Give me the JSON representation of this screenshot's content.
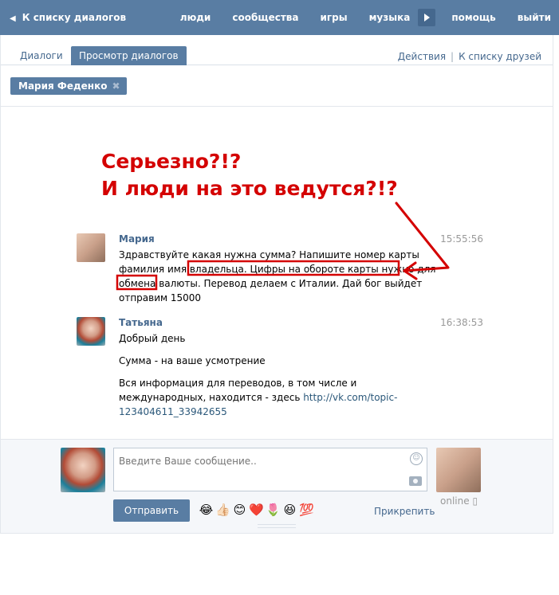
{
  "topbar": {
    "back_label": "К списку диалогов",
    "nav": [
      "люди",
      "сообщества",
      "игры",
      "музыка",
      "помощь",
      "выйти"
    ]
  },
  "tabs": {
    "items": [
      "Диалоги",
      "Просмотр диалогов"
    ],
    "actions_label": "Действия",
    "friends_label": "К списку друзей"
  },
  "chip": {
    "name": "Мария Феденко",
    "remove": "✖"
  },
  "annotation": {
    "line1": "Серьезно?!?",
    "line2": "И люди на это ведутся?!?",
    "color": "#d40000"
  },
  "messages": [
    {
      "name": "Мария",
      "time": "15:55:56",
      "lines": [
        "Здравствуйте какая нужна сумма? Напишите номер карты фамилия имя владельца. Цифры на обороте карты нужно для обмена валюты. Перевод делаем с Италии. Дай бог выйдет отправим 15000"
      ]
    },
    {
      "name": "Татьяна",
      "time": "16:38:53",
      "p1": "Добрый день",
      "p2": "Сумма - на ваше усмотрение",
      "p3": "Вся информация для переводов, в том числе и международных, находится - здесь ",
      "link": "http://vk.com/topic-123404611_33942655"
    }
  ],
  "composer": {
    "placeholder": "Введите Ваше сообщение..",
    "send_label": "Отправить",
    "emojis": [
      "😂",
      "👍🏻",
      "😊",
      "❤️",
      "🌷",
      "😆",
      "💯"
    ],
    "attach_label": "Прикрепить",
    "status": "online"
  },
  "colors": {
    "brand": "#597da3",
    "link": "#45688e"
  }
}
